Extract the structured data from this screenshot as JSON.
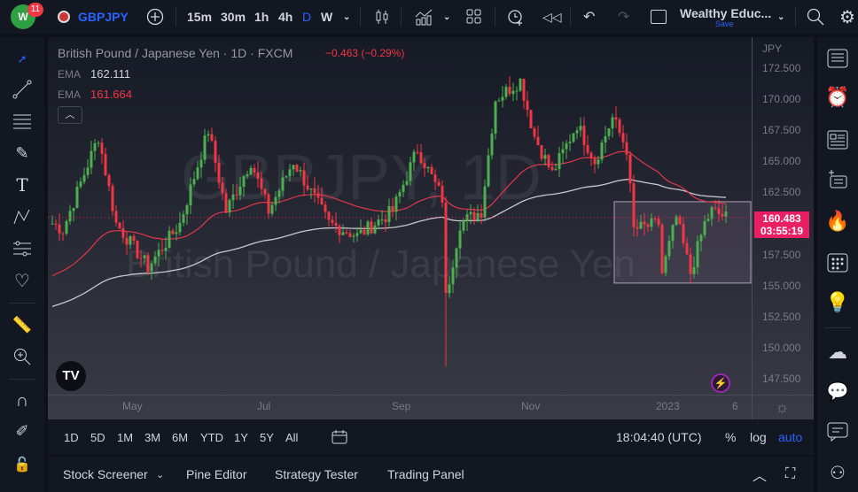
{
  "topbar": {
    "badge": "11",
    "symbol": "GBPJPY",
    "intervals": [
      "15m",
      "30m",
      "1h",
      "4h",
      "D",
      "W"
    ],
    "active_interval": "D",
    "layout_name": "Wealthy Educ...",
    "save_label": "Save"
  },
  "legend": {
    "title": "British Pound / Japanese Yen · 1D · FXCM",
    "change": "−0.463 (−0.29%)",
    "ema1_label": "EMA",
    "ema1_value": "162.111",
    "ema2_label": "EMA",
    "ema2_value": "161.664"
  },
  "watermark": {
    "symbol": "GBPJPY, 1D",
    "name": "British Pound / Japanese Yen"
  },
  "price_axis": {
    "currency": "JPY",
    "ticks": [
      "172.500",
      "170.000",
      "167.500",
      "165.000",
      "162.500",
      "157.500",
      "155.000",
      "152.500",
      "150.000",
      "147.500"
    ],
    "last_price": "160.483",
    "countdown": "03:55:19"
  },
  "time_axis": {
    "labels": [
      "May",
      "Jul",
      "Sep",
      "Nov",
      "2023",
      "6"
    ]
  },
  "colors": {
    "up": "#4caf50",
    "down": "#f23645",
    "ema_fast": "#e0364a",
    "ema_slow": "#c8c8cc",
    "accent": "#2962ff",
    "price_tag": "#e91e63"
  },
  "chart_data": {
    "type": "candlestick",
    "ylim": [
      146.5,
      174
    ],
    "last": 160.483,
    "waypoints": [
      [
        0,
        160
      ],
      [
        3,
        159.5
      ],
      [
        13,
        167
      ],
      [
        18,
        160
      ],
      [
        27,
        156.5
      ],
      [
        36,
        160
      ],
      [
        44,
        167.5
      ],
      [
        49,
        161
      ],
      [
        56,
        165
      ],
      [
        61,
        161
      ],
      [
        68,
        165
      ],
      [
        78,
        160
      ],
      [
        86,
        159
      ],
      [
        96,
        161
      ],
      [
        103,
        166
      ],
      [
        110,
        162
      ],
      [
        111,
        154
      ],
      [
        115,
        160
      ],
      [
        121,
        161
      ],
      [
        125,
        170
      ],
      [
        132,
        171.5
      ],
      [
        136,
        167
      ],
      [
        141,
        164
      ],
      [
        148,
        168
      ],
      [
        153,
        165
      ],
      [
        158,
        168.5
      ],
      [
        162,
        166
      ],
      [
        164,
        159.5
      ],
      [
        171,
        160
      ],
      [
        172,
        156
      ],
      [
        176,
        160.5
      ],
      [
        180,
        156
      ],
      [
        184,
        160
      ],
      [
        186,
        161
      ],
      [
        190,
        160.5
      ]
    ],
    "spike": {
      "day": 111,
      "low": 148.5
    },
    "range_box": {
      "top": 161.75,
      "bottom": 155.2
    }
  },
  "bottom_toolbar": {
    "ranges": [
      "1D",
      "5D",
      "1M",
      "3M",
      "6M",
      "YTD",
      "1Y",
      "5Y",
      "All"
    ],
    "clock": "18:04:40 (UTC)",
    "pct": "%",
    "log": "log",
    "auto": "auto"
  },
  "bottom_panel": {
    "tabs": [
      "Stock Screener",
      "Pine Editor",
      "Strategy Tester",
      "Trading Panel"
    ]
  }
}
